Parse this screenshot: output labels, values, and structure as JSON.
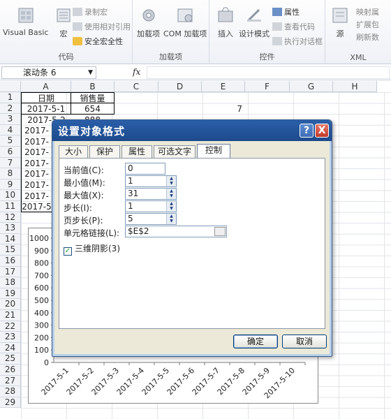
{
  "ribbon": {
    "groups": [
      {
        "label": "代码"
      },
      {
        "label": "加载项"
      },
      {
        "label": "控件"
      },
      {
        "label": "XML"
      }
    ],
    "code": {
      "visual_basic": "Visual Basic",
      "macro": "宏",
      "record_macro": "录制宏",
      "relative_ref": "使用相对引用",
      "macro_security": "安全宏全性"
    },
    "addins": {
      "addins": "加载项",
      "com_addins": "COM 加载项"
    },
    "controls": {
      "insert": "插入",
      "design_mode": "设计模式",
      "properties": "属性",
      "view_code": "查看代码",
      "run_dialog": "执行对话框"
    },
    "xml": {
      "source": "源",
      "map_props": "映射属",
      "expansion": "扩展包",
      "refresh": "刷新数"
    }
  },
  "formula_bar": {
    "name_box": "滚动条 6",
    "fx": "fx",
    "formula": ""
  },
  "sheet": {
    "columns": [
      "A",
      "B",
      "C",
      "D",
      "E",
      "F",
      "G",
      "H"
    ],
    "rows": [
      "1",
      "2",
      "3",
      "4",
      "5",
      "6",
      "7",
      "8",
      "9",
      "10",
      "11",
      "12",
      "13",
      "14",
      "15",
      "16",
      "17",
      "18",
      "19",
      "20",
      "21",
      "22",
      "23",
      "24",
      "25",
      "26",
      "27",
      "28",
      "29"
    ],
    "header_a": "日期",
    "header_b": "销售量",
    "a2": "2017-5-1",
    "b2": "654",
    "e2": "7",
    "a3": "2017-5-2",
    "b3": "888",
    "a4": "2017-",
    "a5": "2017-",
    "a6": "2017-",
    "a7": "2017-",
    "a8": "2017-",
    "a9": "2017-",
    "a10": "2017-",
    "a11": "2017-5"
  },
  "chart_data": {
    "type": "bar",
    "categories": [
      "2017-5-1",
      "2017-5-2",
      "2017-5-3",
      "2017-5-4",
      "2017-5-5",
      "2017-5-6",
      "2017-5-7",
      "2017-5-8",
      "2017-5-9",
      "2017-5-10"
    ],
    "values": [],
    "title": "",
    "xlabel": "",
    "ylabel": "",
    "ylim": [
      0,
      1000
    ],
    "yticks": [
      "1000",
      "900",
      "800",
      "700",
      "600",
      "500",
      "400",
      "300",
      "200",
      "100",
      "0"
    ]
  },
  "dialog": {
    "title": "设置对象格式",
    "help": "?",
    "close": "X",
    "tabs": [
      "大小",
      "保护",
      "属性",
      "可选文字",
      "控制"
    ],
    "fields": {
      "current_label": "当前值(C):",
      "current_value": "0",
      "min_label": "最小值(M):",
      "min_value": "1",
      "max_label": "最大值(X):",
      "max_value": "31",
      "step_label": "步长(I):",
      "step_value": "1",
      "page_label": "页步长(P):",
      "page_value": "5",
      "link_label": "单元格链接(L):",
      "link_value": "$E$2",
      "shading_label": "三维阴影(3)"
    },
    "ok": "确定",
    "cancel": "取消"
  }
}
